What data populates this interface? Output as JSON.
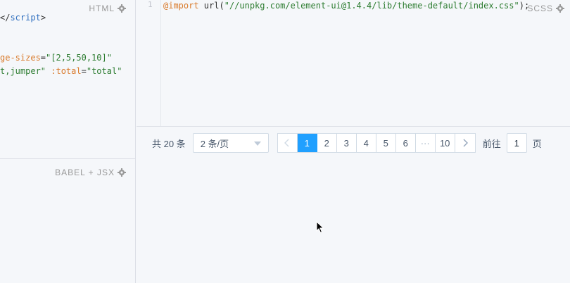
{
  "html_pane": {
    "label": "HTML",
    "lines": [
      {
        "parts": [
          {
            "t": "</",
            "c": "#333333"
          },
          {
            "t": "script",
            "c": "#2f6fbf"
          },
          {
            "t": ">",
            "c": "#333333"
          }
        ]
      },
      {
        "parts": [
          {
            "t": "ge-sizes",
            "c": "#d97a2b"
          },
          {
            "t": "=",
            "c": "#333333"
          },
          {
            "t": "\"[2,5,50,10]\"",
            "c": "#2e7d32"
          }
        ]
      },
      {
        "parts": [
          {
            "t": "t,jumper\"",
            "c": "#2e7d32"
          },
          {
            "t": " :total",
            "c": "#d97a2b"
          },
          {
            "t": "=",
            "c": "#333333"
          },
          {
            "t": "\"total\"",
            "c": "#2e7d32"
          }
        ]
      }
    ]
  },
  "babel_pane": {
    "label": "BABEL + JSX"
  },
  "scss_pane": {
    "label": "SCSS",
    "line_number": "1",
    "code_parts": [
      {
        "t": "@import",
        "c": "#d97a2b"
      },
      {
        "t": " url(",
        "c": "#333333"
      },
      {
        "t": "\"//unpkg.com/element-ui@1.4.4/lib/theme-default/index.css\"",
        "c": "#2e7d32"
      },
      {
        "t": ");",
        "c": "#333333"
      }
    ]
  },
  "pagination": {
    "total_text": "共 20 条",
    "page_size_text": "2 条/页",
    "pages": [
      "1",
      "2",
      "3",
      "4",
      "5",
      "6"
    ],
    "ellipsis": "···",
    "last_page": "10",
    "current_page": "1",
    "jump_prefix": "前往",
    "jump_value": "1",
    "jump_suffix": "页"
  },
  "colors": {
    "accent": "#20a0ff",
    "background": "#f5f7fa",
    "border": "#d1dbe5",
    "label": "#999999"
  },
  "icons": [
    "gear-icon",
    "prev-chevron-icon",
    "next-chevron-icon",
    "dropdown-arrow-icon",
    "mouse-cursor-icon"
  ]
}
